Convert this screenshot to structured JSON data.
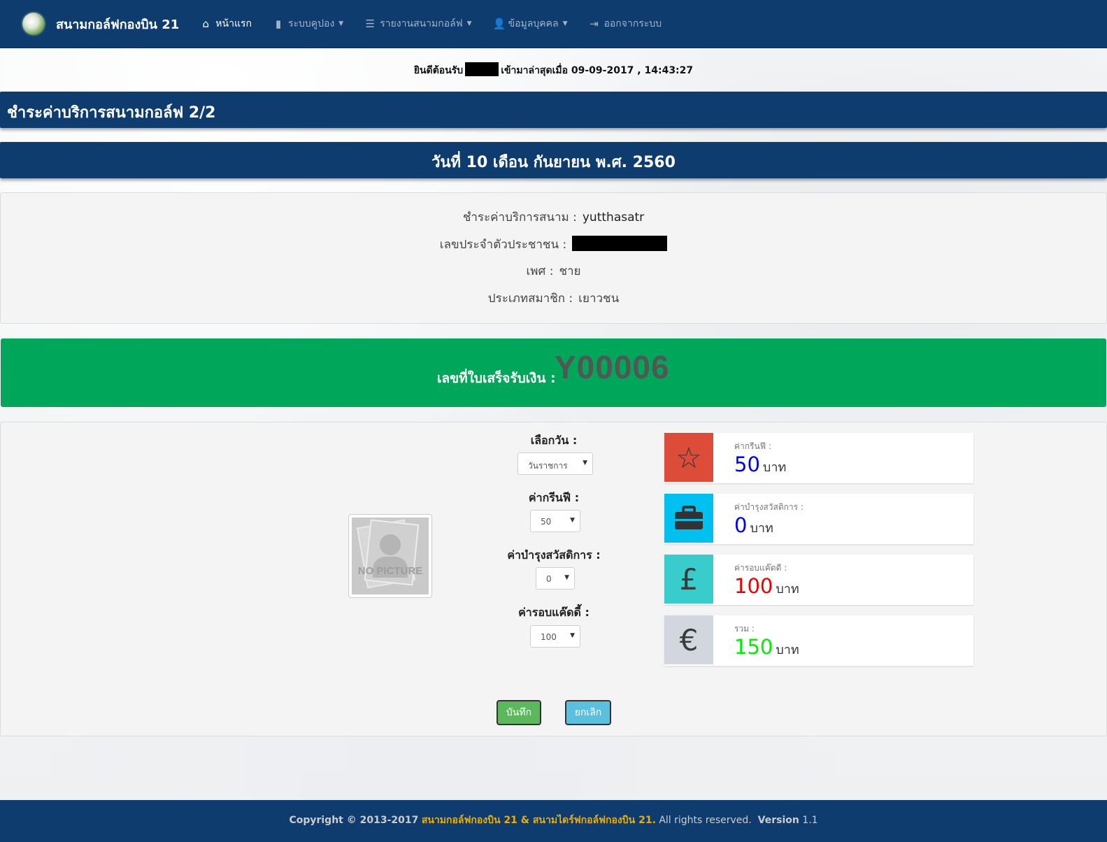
{
  "colors": {
    "navbar": "#0f3c6e",
    "receipt_banner": "#00a65a",
    "greenfee_box": "#dd4b39",
    "welfare_box": "#00c0ef",
    "caddy_box": "#39cccc",
    "total_box": "#d2d6de",
    "value_blue": "#0000ee",
    "value_red": "#ee0000",
    "value_green": "#00ee00",
    "footer_highlight": "#f0ad00"
  },
  "navbar": {
    "brand": "สนามกอล์ฟกองบิน 21",
    "items": [
      {
        "label": "หน้าแรก",
        "icon": "home-icon",
        "dropdown": false,
        "active": true
      },
      {
        "label": "ระบบคูปอง",
        "icon": "file-icon",
        "dropdown": true,
        "active": false
      },
      {
        "label": "รายงานสนามกอล์ฟ",
        "icon": "list-icon",
        "dropdown": true,
        "active": false
      },
      {
        "label": "ข้อมูลบุคคล",
        "icon": "user-icon",
        "dropdown": true,
        "active": false
      },
      {
        "label": "ออกจากระบบ",
        "icon": "logout-icon",
        "dropdown": false,
        "active": false
      }
    ]
  },
  "welcome": {
    "prefix": "ยินดีต้อนรับ",
    "last_login_label": "เข้ามาล่าสุดเมื่อ",
    "last_login_value": "09-09-2017 , 14:43:27"
  },
  "page_title": "ชำระค่าบริการสนามกอล์ฟ 2/2",
  "date_header": "วันที่ 10 เดือน กันยายน พ.ศ. 2560",
  "member": {
    "name_label": "ชำระค่าบริการสนาม :",
    "name_value": "yutthasatr",
    "id_label": "เลขประจำตัวประชาชน :",
    "gender_label": "เพศ :",
    "gender_value": "ชาย",
    "type_label": "ประเภทสมาชิก :",
    "type_value": "เยาวชน"
  },
  "receipt": {
    "label": "เลขที่ใบเสร็จรับเงิน :",
    "number": "Y00006"
  },
  "photo": {
    "text": "NO PICTURE"
  },
  "form": {
    "day_label": "เลือกวัน :",
    "day_value": "วันราชการ",
    "greenfee_label": "ค่ากรีนฟี :",
    "greenfee_value": "50",
    "welfare_label": "ค่าบำรุงสวัสดิการ :",
    "welfare_value": "0",
    "caddy_label": "ค่ารอบแค๊ดดี้ :",
    "caddy_value": "100"
  },
  "summary": {
    "greenfee": {
      "label": "ค่ากรีนฟี :",
      "value": "50",
      "unit": "บาท",
      "icon": "star-icon"
    },
    "welfare": {
      "label": "ค่าบำรุงสวัสดิการ :",
      "value": "0",
      "unit": "บาท",
      "icon": "briefcase-icon"
    },
    "caddy": {
      "label": "ค่ารอบแค๊ดดี :",
      "value": "100",
      "unit": "บาท",
      "icon": "pound-icon"
    },
    "total": {
      "label": "รวม :",
      "value": "150",
      "unit": "บาท",
      "icon": "euro-icon"
    }
  },
  "buttons": {
    "save": "บันทึก",
    "cancel": "ยกเลิก"
  },
  "footer": {
    "copyright": "Copyright © 2013-2017",
    "org": "สนามกอล์ฟกองบิน 21 & สนามไดร์ฟกอล์ฟกองบิน 21.",
    "rights": "All rights reserved.",
    "version_label": "Version",
    "version_value": "1.1"
  }
}
